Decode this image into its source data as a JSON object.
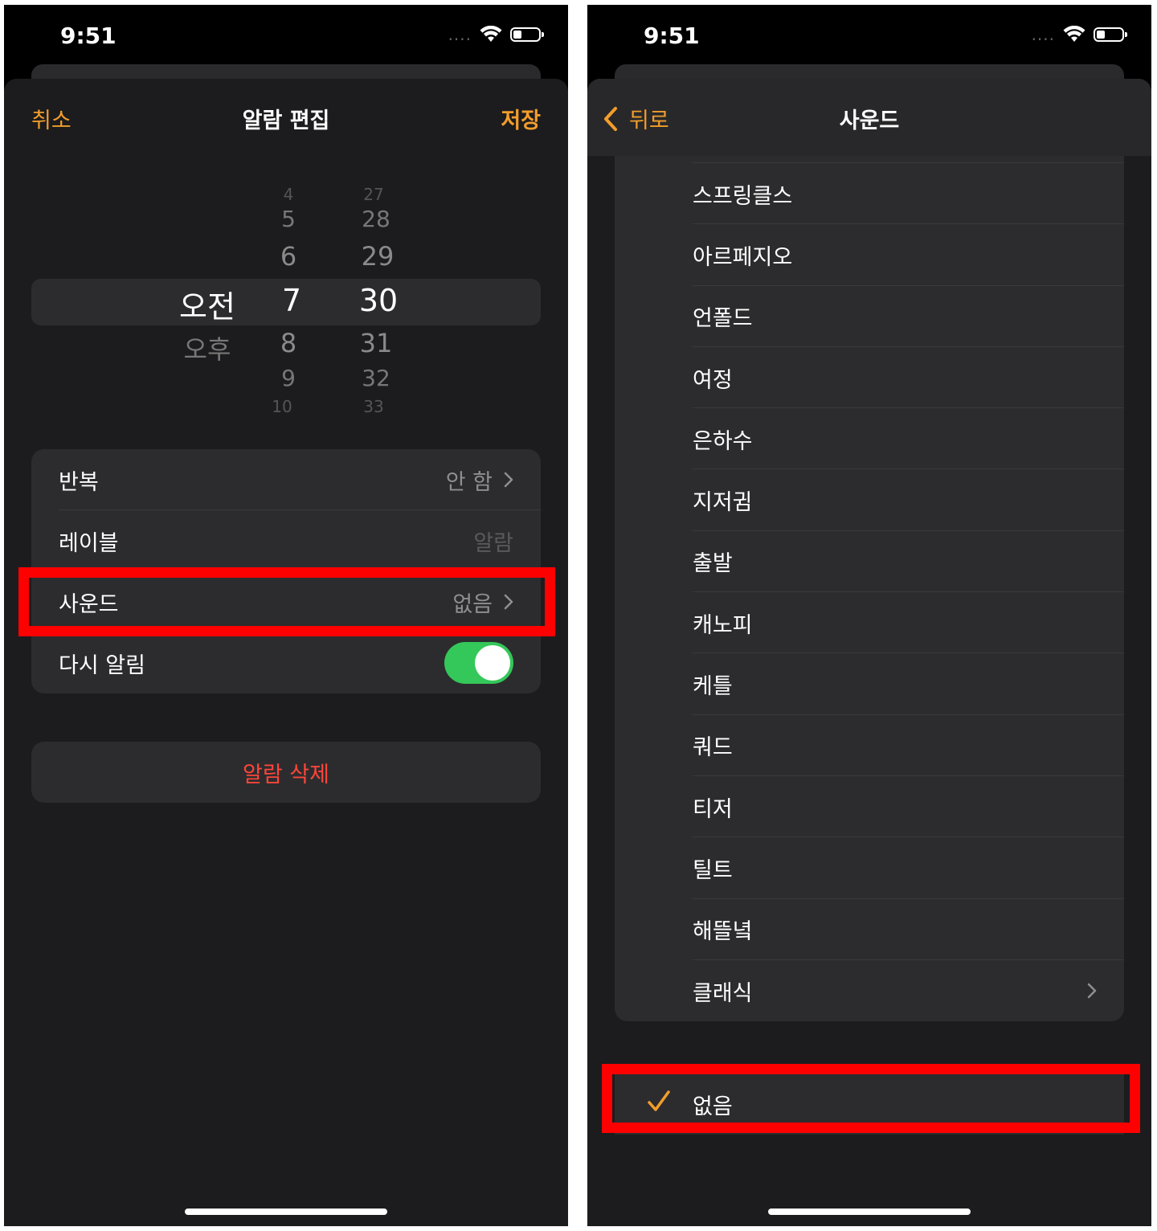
{
  "status": {
    "time": "9:51",
    "signal": "....",
    "icons": [
      "wifi-icon",
      "battery-icon"
    ]
  },
  "left": {
    "nav": {
      "cancel": "취소",
      "title": "알람 편집",
      "save": "저장"
    },
    "picker": {
      "ampm": [
        "오전",
        "오후"
      ],
      "hours": [
        "4",
        "5",
        "6",
        "7",
        "8",
        "9",
        "10"
      ],
      "minutes": [
        "27",
        "28",
        "29",
        "30",
        "31",
        "32",
        "33"
      ],
      "selected": {
        "ampm": "오전",
        "hour": "7",
        "minute": "30"
      }
    },
    "settings": {
      "repeat": {
        "label": "반복",
        "value": "안 함"
      },
      "label": {
        "label": "레이블",
        "value": "알람"
      },
      "sound": {
        "label": "사운드",
        "value": "없음"
      },
      "snooze": {
        "label": "다시 알림",
        "on": true
      }
    },
    "delete": "알람 삭제"
  },
  "right": {
    "nav": {
      "back": "뒤로",
      "title": "사운드"
    },
    "sounds": [
      "스프링클스",
      "아르페지오",
      "언폴드",
      "여정",
      "은하수",
      "지저귐",
      "출발",
      "캐노피",
      "케틀",
      "쿼드",
      "티저",
      "틸트",
      "해뜰녘",
      "클래식"
    ],
    "none_option": {
      "label": "없음",
      "checked": true
    }
  },
  "colors": {
    "accent": "#f29d2c",
    "destructive": "#ff453a",
    "toggle_on": "#34c759",
    "highlight": "#ff0000"
  }
}
